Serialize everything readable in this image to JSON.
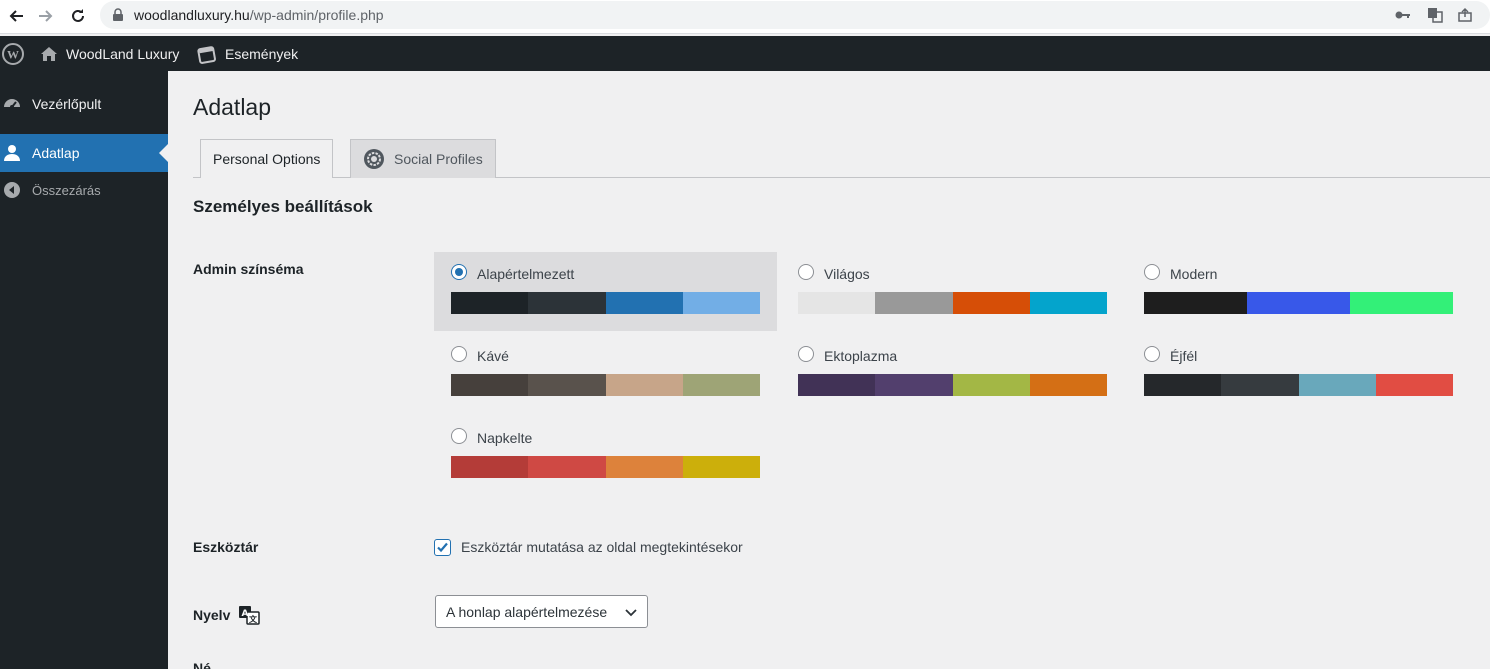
{
  "browser": {
    "url_host": "woodlandluxury.hu",
    "url_path": "/wp-admin/profile.php"
  },
  "adminbar": {
    "site_name": "WoodLand Luxury",
    "events_label": "Események"
  },
  "sidebar": {
    "items": [
      {
        "label": "Vezérlőpult",
        "icon": "dashboard-icon"
      },
      {
        "label": "Adatlap",
        "icon": "user-icon",
        "current": true
      },
      {
        "label": "Összezárás",
        "icon": "collapse-icon"
      }
    ]
  },
  "page": {
    "title": "Adatlap",
    "tabs": [
      {
        "label": "Personal Options",
        "active": true
      },
      {
        "label": "Social Profiles",
        "icon": "gear-icon"
      }
    ],
    "section_title": "Személyes beállítások"
  },
  "color_scheme": {
    "label": "Admin színséma",
    "schemes": [
      {
        "name": "Alapértelmezett",
        "selected": true,
        "colors": [
          "#1d2327",
          "#2c3338",
          "#2271b1",
          "#72aee6"
        ]
      },
      {
        "name": "Világos",
        "selected": false,
        "colors": [
          "#e5e5e5",
          "#999999",
          "#d64e07",
          "#04a4cc"
        ]
      },
      {
        "name": "Modern",
        "selected": false,
        "colors": [
          "#1e1e1e",
          "#3858e9",
          "#33f078"
        ]
      },
      {
        "name": "Kávé",
        "selected": false,
        "colors": [
          "#46403c",
          "#59524c",
          "#c7a589",
          "#9ea476"
        ]
      },
      {
        "name": "Ektoplazma",
        "selected": false,
        "colors": [
          "#413256",
          "#523f6d",
          "#a3b745",
          "#d46f15"
        ]
      },
      {
        "name": "Éjfél",
        "selected": false,
        "colors": [
          "#25282b",
          "#363b3f",
          "#69a8bb",
          "#e14d43"
        ]
      },
      {
        "name": "Napkelte",
        "selected": false,
        "colors": [
          "#b43c38",
          "#cf4944",
          "#dd823b",
          "#ccaf0b"
        ]
      }
    ]
  },
  "toolbar": {
    "label": "Eszköztár",
    "checkbox_label": "Eszköztár mutatása az oldal megtekintésekor",
    "checked": true
  },
  "language": {
    "label": "Nyelv",
    "selected": "A honlap alapértelmezése"
  },
  "next_label_partial": "Né"
}
